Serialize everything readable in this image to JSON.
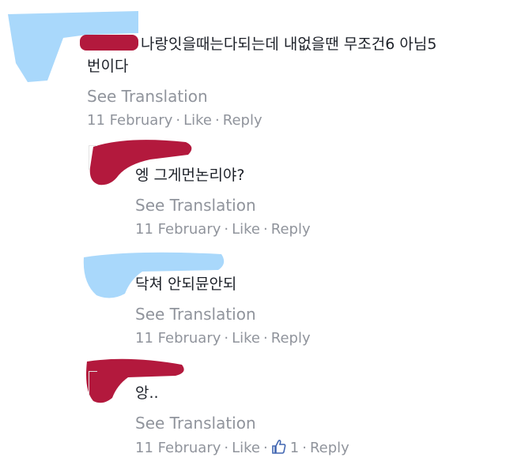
{
  "comments": [
    {
      "line1": "나랑잇을때는다되는데 내없을땐 무조건6 아님5",
      "line2": "번이다",
      "see_translation": "See Translation",
      "date": "11 February",
      "like": "Like",
      "reply": "Reply"
    },
    {
      "line1": "엥 그게먼논리야?",
      "see_translation": "See Translation",
      "date": "11 February",
      "like": "Like",
      "reply": "Reply"
    },
    {
      "line1": "닥쳐 안되뮨안되",
      "see_translation": "See Translation",
      "date": "11 February",
      "like": "Like",
      "reply": "Reply"
    },
    {
      "line1": "앙..",
      "see_translation": "See Translation",
      "date": "11 February",
      "like": "Like",
      "like_count": "1",
      "reply": "Reply"
    }
  ],
  "icons": {
    "like": "thumbs-up-icon"
  },
  "colors": {
    "meta_gray": "#90949c",
    "like_blue": "#4267b2",
    "redact_blue": "#a9d8fb",
    "redact_red": "#b3193d"
  }
}
